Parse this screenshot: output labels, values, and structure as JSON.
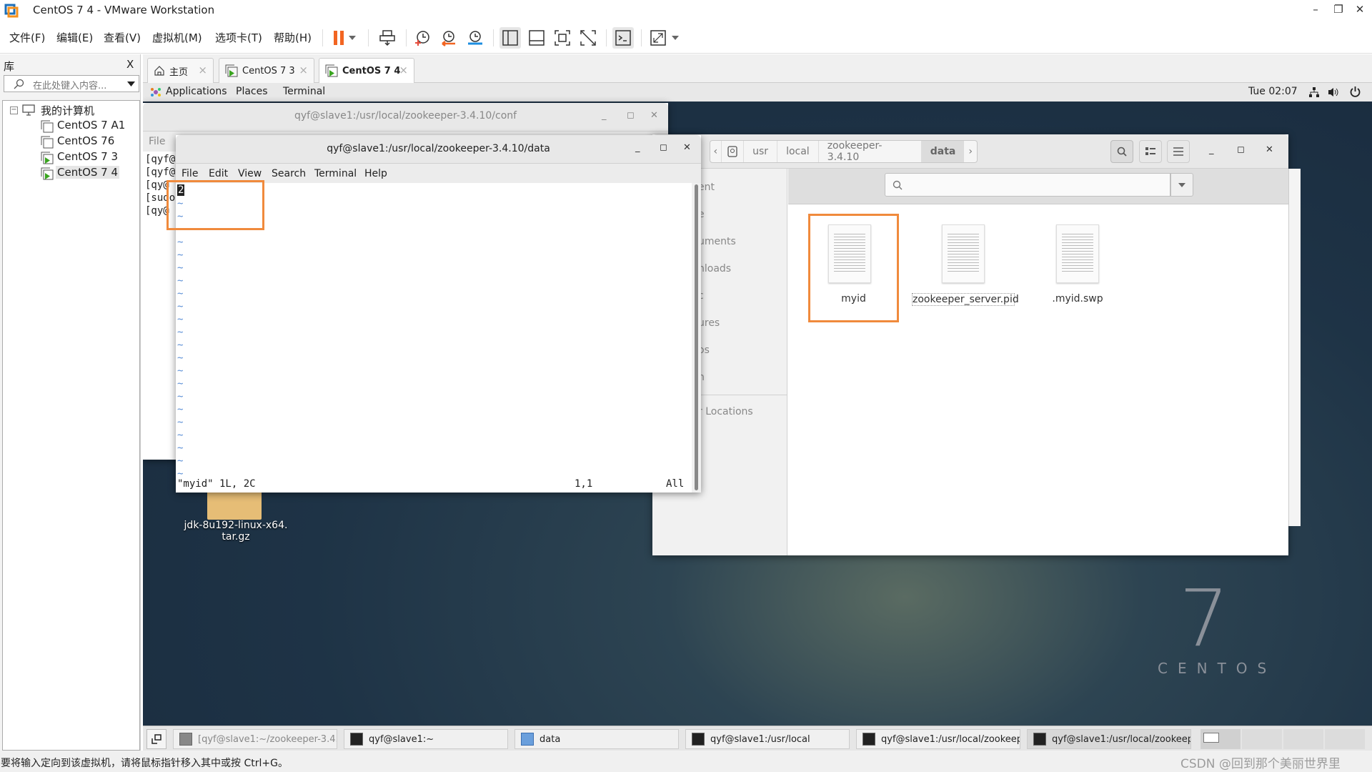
{
  "window": {
    "title": "CentOS 7 4 - VMware Workstation",
    "controls": {
      "minimize": "–",
      "restore": "❐",
      "close": "✕"
    }
  },
  "menubar": {
    "items": [
      "文件(F)",
      "编辑(E)",
      "查看(V)",
      "虚拟机(M)",
      "选项卡(T)",
      "帮助(H)"
    ]
  },
  "toolbar": {
    "icons": [
      "pause-icon",
      "send-ctrl-alt-del-icon",
      "snapshot-take-icon",
      "snapshot-revert-icon",
      "snapshot-manager-icon",
      "show-library-icon",
      "show-thumbnail-icon",
      "full-screen-icon",
      "unity-icon",
      "console-view-icon",
      "stretch-icon"
    ]
  },
  "library": {
    "title": "库",
    "close": "X",
    "search_placeholder": "在此处键入内容...",
    "root": "我的计算机",
    "vms": [
      {
        "name": "CentOS 7 A1",
        "running": false
      },
      {
        "name": "CentOS 76",
        "running": false
      },
      {
        "name": "CentOS 7 3",
        "running": true
      },
      {
        "name": "CentOS 7 4",
        "running": true,
        "selected": true
      }
    ]
  },
  "vm_tabs": [
    {
      "label": "主页",
      "icon": "home-icon",
      "active": false
    },
    {
      "label": "CentOS 7 3",
      "icon": "vm-icon",
      "active": false
    },
    {
      "label": "CentOS 7 4",
      "icon": "vm-icon",
      "active": true
    }
  ],
  "gnome_panel": {
    "applications": "Applications",
    "places": "Places",
    "terminal": "Terminal",
    "clock": "Tue 02:07"
  },
  "terminal_back": {
    "title": "qyf@slave1:/usr/local/zookeeper-3.4.10/conf",
    "menu_file": "File",
    "lines": [
      "[qyf@",
      "[qyf@",
      "[qy@",
      "[sudo",
      "[qy@"
    ]
  },
  "vim_terminal": {
    "title": "qyf@slave1:/usr/local/zookeeper-3.4.10/data",
    "menu": [
      "File",
      "Edit",
      "View",
      "Search",
      "Terminal",
      "Help"
    ],
    "content_first_line": "2",
    "tilde_count": 22,
    "status_left": "\"myid\" 1L, 2C",
    "status_pos": "1,1",
    "status_right": "All"
  },
  "file_manager": {
    "path": [
      "usr",
      "local",
      "zookeeper-3.4.10",
      "data"
    ],
    "current": "data",
    "sidebar_items": [
      "ent",
      "e",
      "uments",
      "nloads",
      "c",
      "ures",
      "os",
      "h"
    ],
    "other_locations": "r Locations",
    "files": [
      {
        "name": "myid",
        "highlighted": true
      },
      {
        "name": "zookeeper_server.pid",
        "highlighted": false
      },
      {
        "name": ".myid.swp",
        "highlighted": false
      }
    ]
  },
  "desktop": {
    "icon_label_1": "jdk-8u192-linux-x64.",
    "icon_label_2": "tar.gz",
    "logo_number": "7",
    "logo_text": "CENTOS"
  },
  "taskbar": {
    "items": [
      {
        "label": "[qyf@slave1:~/zookeeper-3.4....",
        "icon": "terminal-icon",
        "active": false
      },
      {
        "label": "qyf@slave1:~",
        "icon": "terminal-icon",
        "active": false
      },
      {
        "label": "data",
        "icon": "file-manager-icon",
        "active": false
      },
      {
        "label": "qyf@slave1:/usr/local",
        "icon": "terminal-icon",
        "active": false
      },
      {
        "label": "qyf@slave1:/usr/local/zookeep...",
        "icon": "terminal-icon",
        "active": false
      },
      {
        "label": "qyf@slave1:/usr/local/zookeep...",
        "icon": "terminal-icon",
        "active": true
      }
    ]
  },
  "statusbar": {
    "text": "要将输入定向到该虚拟机，请将鼠标指针移入其中或按 Ctrl+G。",
    "watermark": "CSDN @回到那个美丽世界里"
  },
  "colors": {
    "highlight": "#f08a3c",
    "pause": "#f26522"
  }
}
